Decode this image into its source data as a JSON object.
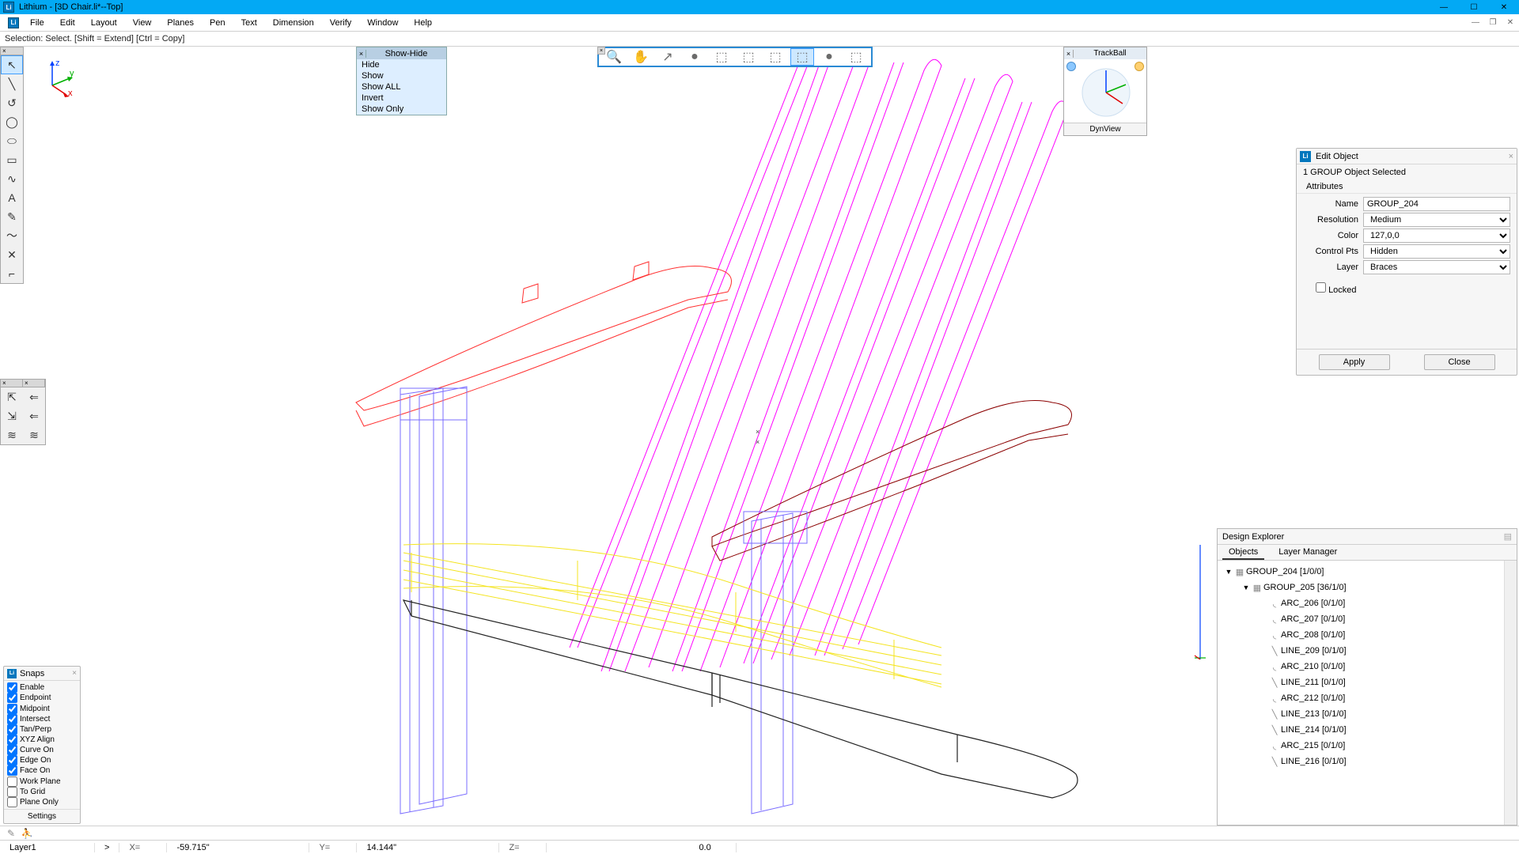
{
  "titlebar": {
    "text": "Lithium - [3D Chair.li*--Top]"
  },
  "menu": {
    "items": [
      "File",
      "Edit",
      "Layout",
      "View",
      "Planes",
      "Pen",
      "Text",
      "Dimension",
      "Verify",
      "Window",
      "Help"
    ]
  },
  "hint": "Selection: Select.  [Shift = Extend]  [Ctrl = Copy]",
  "showhide": {
    "title": "Show-Hide",
    "items": [
      "Hide",
      "Show",
      "Show ALL",
      "Invert",
      "Show Only"
    ]
  },
  "trackball": {
    "title": "TrackBall",
    "footer": "DynView"
  },
  "editobj": {
    "title": "Edit Object",
    "selection": "1 GROUP Object Selected",
    "section": "Attributes",
    "fields": {
      "name_label": "Name",
      "name_value": "GROUP_204",
      "res_label": "Resolution",
      "res_value": "Medium",
      "color_label": "Color",
      "color_value": "127,0,0",
      "ctrl_label": "Control Pts",
      "ctrl_value": "Hidden",
      "layer_label": "Layer",
      "layer_value": "Braces"
    },
    "locked": "Locked",
    "apply": "Apply",
    "close": "Close"
  },
  "explorer": {
    "title": "Design Explorer",
    "tabs": [
      "Objects",
      "Layer Manager"
    ],
    "nodes": [
      {
        "indent": 0,
        "twisty": "▼",
        "icon": "grp",
        "label": "GROUP_204 [1/0/0]"
      },
      {
        "indent": 1,
        "twisty": "▼",
        "icon": "grp",
        "label": "GROUP_205 [36/1/0]"
      },
      {
        "indent": 2,
        "twisty": "",
        "icon": "arc",
        "label": "ARC_206 [0/1/0]"
      },
      {
        "indent": 2,
        "twisty": "",
        "icon": "arc",
        "label": "ARC_207 [0/1/0]"
      },
      {
        "indent": 2,
        "twisty": "",
        "icon": "arc",
        "label": "ARC_208 [0/1/0]"
      },
      {
        "indent": 2,
        "twisty": "",
        "icon": "line",
        "label": "LINE_209 [0/1/0]"
      },
      {
        "indent": 2,
        "twisty": "",
        "icon": "arc",
        "label": "ARC_210 [0/1/0]"
      },
      {
        "indent": 2,
        "twisty": "",
        "icon": "line",
        "label": "LINE_211 [0/1/0]"
      },
      {
        "indent": 2,
        "twisty": "",
        "icon": "arc",
        "label": "ARC_212 [0/1/0]"
      },
      {
        "indent": 2,
        "twisty": "",
        "icon": "line",
        "label": "LINE_213 [0/1/0]"
      },
      {
        "indent": 2,
        "twisty": "",
        "icon": "line",
        "label": "LINE_214 [0/1/0]"
      },
      {
        "indent": 2,
        "twisty": "",
        "icon": "arc",
        "label": "ARC_215 [0/1/0]"
      },
      {
        "indent": 2,
        "twisty": "",
        "icon": "line",
        "label": "LINE_216 [0/1/0]"
      }
    ]
  },
  "snaps": {
    "title": "Snaps",
    "opts": [
      {
        "label": "Enable",
        "checked": true
      },
      {
        "label": "Endpoint",
        "checked": true
      },
      {
        "label": "Midpoint",
        "checked": true
      },
      {
        "label": "Intersect",
        "checked": true
      },
      {
        "label": "Tan/Perp",
        "checked": true
      },
      {
        "label": "XYZ Align",
        "checked": true
      },
      {
        "label": "Curve On",
        "checked": true
      },
      {
        "label": "Edge On",
        "checked": true
      },
      {
        "label": "Face On",
        "checked": true
      },
      {
        "label": "Work Plane",
        "checked": false
      },
      {
        "label": "To Grid",
        "checked": false
      },
      {
        "label": "Plane Only",
        "checked": false
      }
    ],
    "settings": "Settings"
  },
  "status": {
    "layer": "Layer1",
    "x_lbl": "X=",
    "x": "-59.715\"",
    "y_lbl": "Y=",
    "y": "14.144\"",
    "z_lbl": "Z=",
    "z": "",
    "extra": "0.0"
  },
  "tool_icons": [
    "↖",
    "╲",
    "↺",
    "◯",
    "⬭",
    "▭",
    "∿",
    "A",
    "✎",
    "～",
    "✕",
    "⌐"
  ],
  "tool2_icons": [
    [
      "⇱",
      "⇐"
    ],
    [
      "⇲",
      "⇐"
    ],
    [
      "≋",
      "≋"
    ]
  ],
  "view_icons": [
    "🔍",
    "✋",
    "↗",
    "●",
    "⬚",
    "⬚",
    "⬚",
    "⬚",
    "●",
    "⬚"
  ],
  "arrow": ">"
}
